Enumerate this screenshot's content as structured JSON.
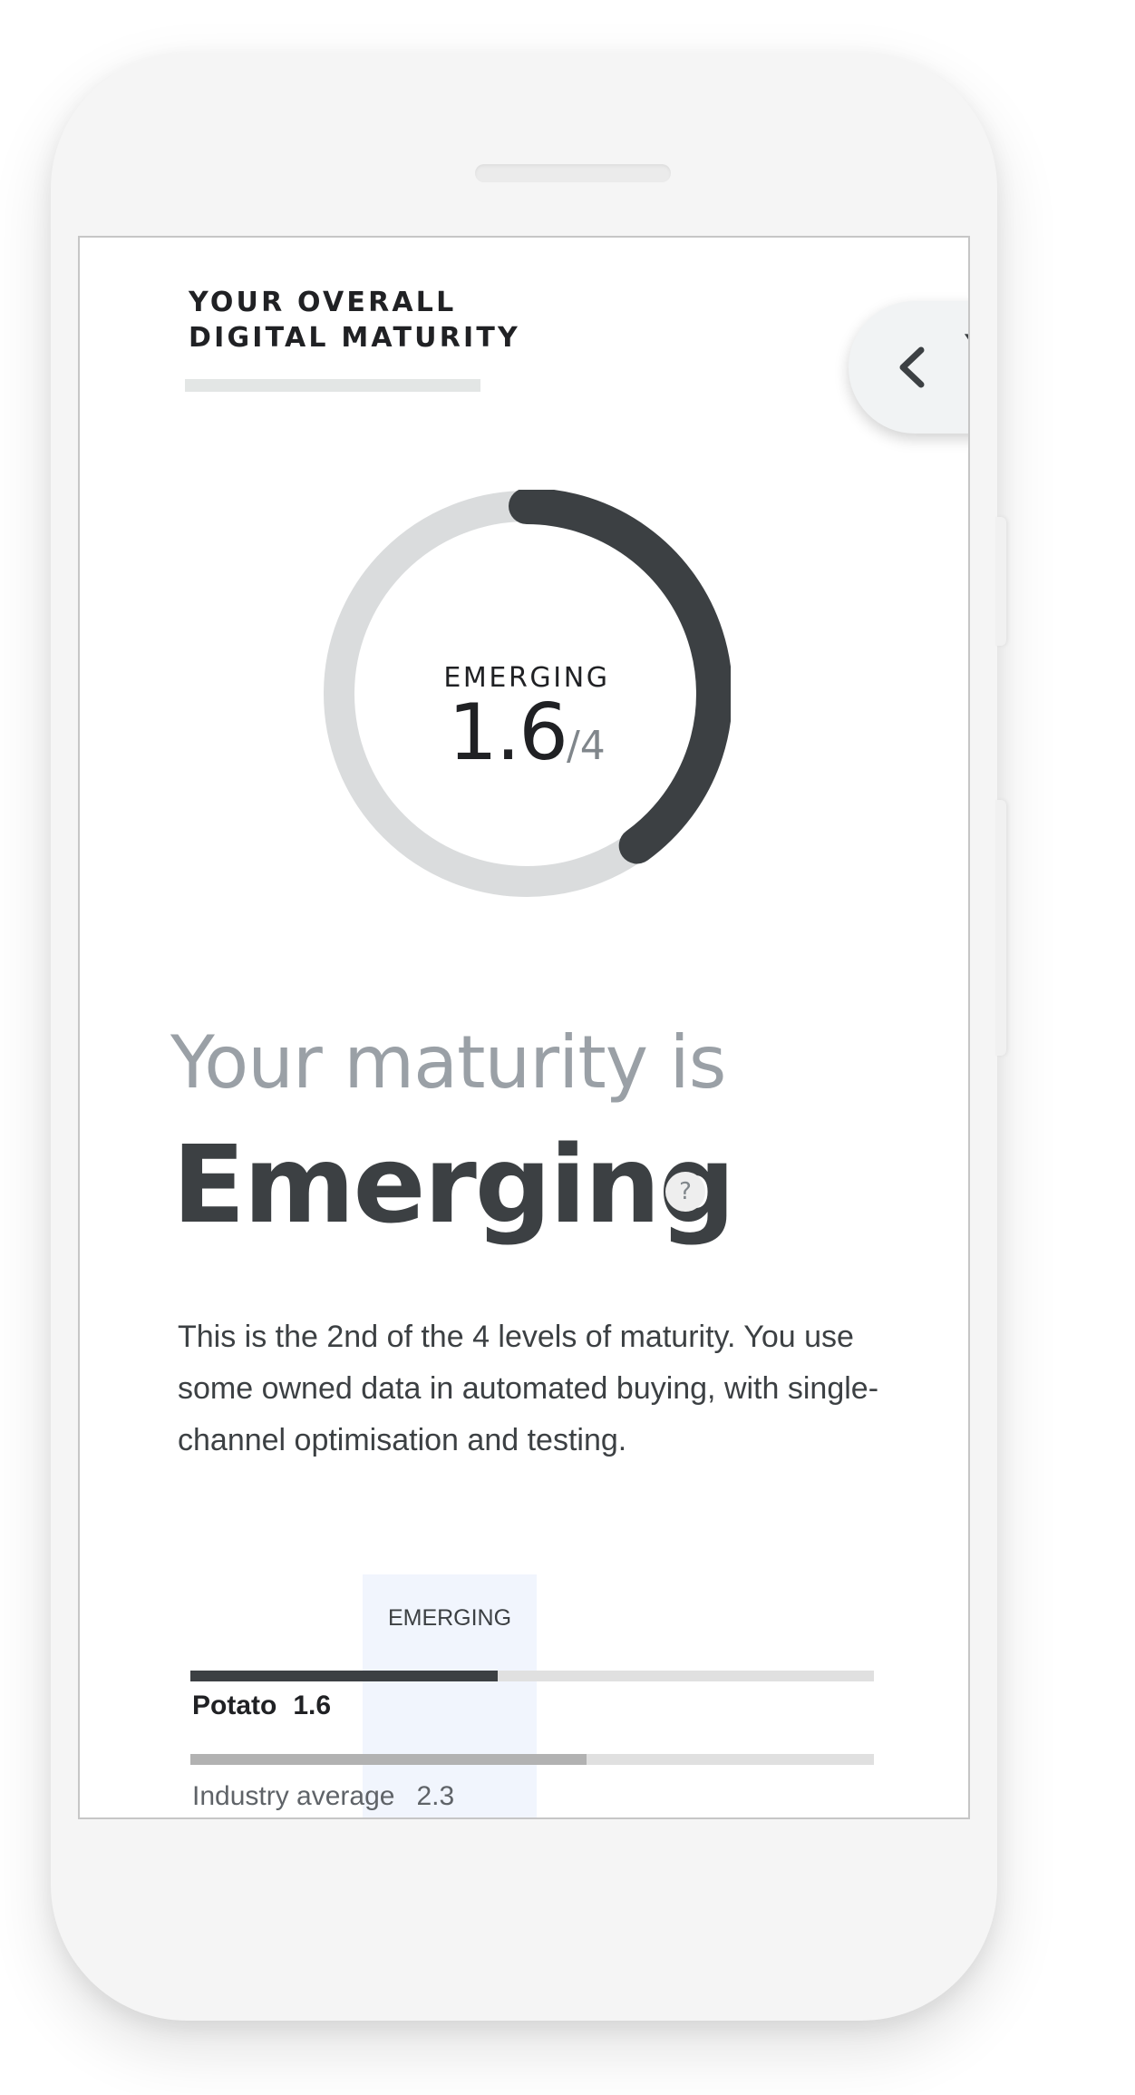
{
  "header": {
    "title_line1": "YOUR OVERALL",
    "title_line2": "DIGITAL MATURITY"
  },
  "nav": {
    "back_icon": "chevron-left-icon",
    "next_peek_text": "Y"
  },
  "gauge": {
    "level_label": "EMERGING",
    "score": "1.6",
    "max": "/4",
    "score_value": 1.6,
    "max_value": 4,
    "track_color": "#dadcdd",
    "fill_color": "#3c4043"
  },
  "heading": {
    "prefix": "Your maturity is",
    "level": "Emerging",
    "help_icon": "help-icon",
    "help_symbol": "?"
  },
  "description": "This is the 2nd of the 4 levels of maturity. You use some owned data in automated buying, with single-channel optimisation and testing.",
  "comparison": {
    "highlight_label": "EMERGING",
    "rows": [
      {
        "name": "Potato",
        "value": "1.6",
        "fill_fraction": 0.45,
        "color": "#3c4043"
      },
      {
        "name": "Industry average",
        "value": "2.3",
        "fill_fraction": 0.58,
        "color": "#b2b2b2"
      }
    ]
  }
}
